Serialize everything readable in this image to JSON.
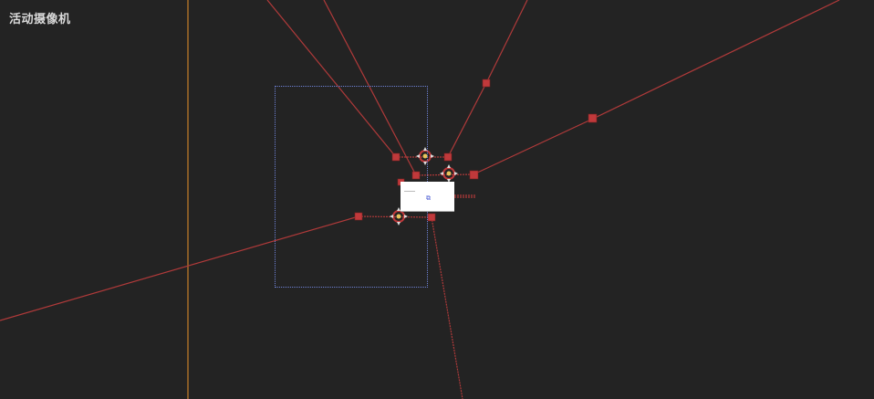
{
  "viewport": {
    "camera_label": "活动摄像机"
  },
  "colors": {
    "background": "#232323",
    "link_line": "#b03a3a",
    "handle": "#c0393b",
    "axis_line": "#c9802a",
    "selection": "#6e82d6",
    "node_card": "#ffffff"
  },
  "icons": {
    "gizmo": "target-crosshair-icon",
    "handle": "square-handle-icon",
    "node_glyph": "node-glyph-icon"
  },
  "node_card": {
    "glyph": "⧉"
  }
}
